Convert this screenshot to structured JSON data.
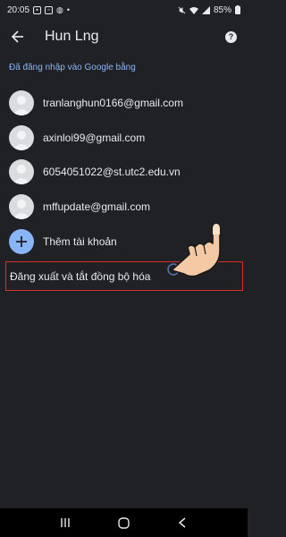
{
  "status_bar": {
    "time": "20:05",
    "battery": "85%"
  },
  "app_bar": {
    "title": "Hun Lng",
    "help_icon": "help-icon",
    "back_icon": "back-arrow-icon"
  },
  "section": {
    "signed_in_label": "Đã đăng nhập vào Google bằng"
  },
  "accounts": [
    {
      "email": "tranlanghun0166@gmail.com"
    },
    {
      "email": "axinloi99@gmail.com"
    },
    {
      "email": "6054051022@st.utc2.edu.vn"
    },
    {
      "email": "mffupdate@gmail.com"
    }
  ],
  "add_account": {
    "label": "Thêm tài khoản"
  },
  "sign_out": {
    "label": "Đăng xuất và tắt đồng bộ hóa"
  },
  "colors": {
    "background": "#202124",
    "accent": "#8ab4f8",
    "highlight": "#d93025"
  }
}
